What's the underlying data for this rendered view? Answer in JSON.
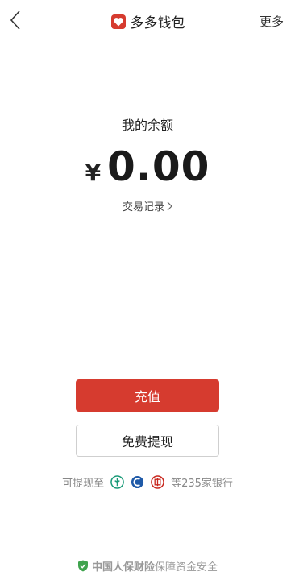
{
  "nav": {
    "title": "多多钱包",
    "more": "更多"
  },
  "wallet": {
    "balance_label": "我的余额",
    "currency": "¥",
    "amount": "0.00",
    "records": "交易记录"
  },
  "actions": {
    "recharge": "充值",
    "withdraw": "免费提现"
  },
  "banks": {
    "prefix": "可提现至",
    "suffix": "等235家银行"
  },
  "footer": {
    "brand": "中国人保财险",
    "text": "保障资金安全"
  },
  "colors": {
    "accent": "#d63b2f",
    "shield": "#3fa34d"
  }
}
